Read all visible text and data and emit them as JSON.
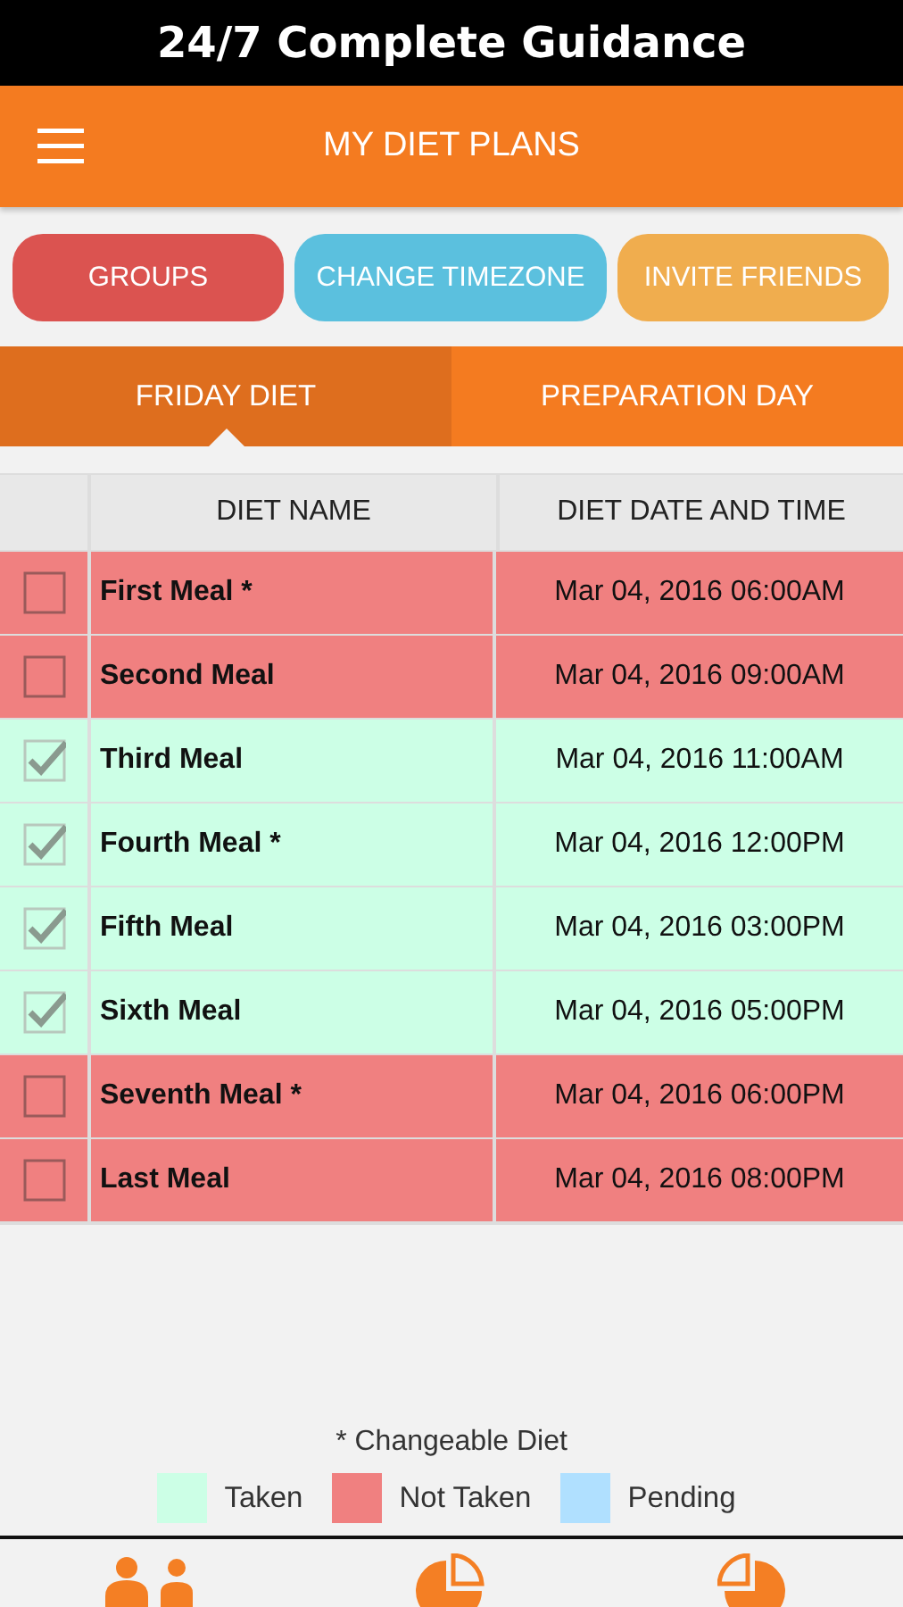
{
  "banner": {
    "title": "24/7 Complete Guidance"
  },
  "header": {
    "title": "MY DIET PLANS"
  },
  "actions": [
    {
      "label": "GROUPS",
      "color": "#db5350"
    },
    {
      "label": "CHANGE TIMEZONE",
      "color": "#5bc0de"
    },
    {
      "label": "INVITE FRIENDS",
      "color": "#f0ad4e"
    }
  ],
  "tabs": [
    {
      "label": "FRIDAY DIET",
      "selected": true
    },
    {
      "label": "PREPARATION DAY",
      "selected": false
    }
  ],
  "table": {
    "columns": [
      "DIET NAME",
      "DIET DATE AND TIME"
    ],
    "rows": [
      {
        "checked": false,
        "color": "#f08080",
        "name": "First Meal *",
        "time": "Mar 04, 2016 06:00AM"
      },
      {
        "checked": false,
        "color": "#f08080",
        "name": "Second Meal",
        "time": "Mar 04, 2016 09:00AM"
      },
      {
        "checked": true,
        "color": "#ccffe6",
        "name": "Third Meal",
        "time": "Mar 04, 2016 11:00AM"
      },
      {
        "checked": true,
        "color": "#ccffe6",
        "name": "Fourth Meal *",
        "time": "Mar 04, 2016 12:00PM"
      },
      {
        "checked": true,
        "color": "#ccffe6",
        "name": "Fifth Meal",
        "time": "Mar 04, 2016 03:00PM"
      },
      {
        "checked": true,
        "color": "#ccffe6",
        "name": "Sixth Meal",
        "time": "Mar 04, 2016 05:00PM"
      },
      {
        "checked": false,
        "color": "#f08080",
        "name": "Seventh Meal *",
        "time": "Mar 04, 2016 06:00PM"
      },
      {
        "checked": false,
        "color": "#f08080",
        "name": "Last Meal",
        "time": "Mar 04, 2016 08:00PM"
      }
    ]
  },
  "note": "* Changeable Diet",
  "legend": [
    {
      "label": "Taken",
      "color": "#ccffe6"
    },
    {
      "label": "Not Taken",
      "color": "#f08080"
    },
    {
      "label": "Pending",
      "color": "#b0e0ff"
    }
  ],
  "bottom_nav": [
    {
      "kind": "people"
    },
    {
      "kind": "pie"
    },
    {
      "kind": "pie2"
    }
  ]
}
